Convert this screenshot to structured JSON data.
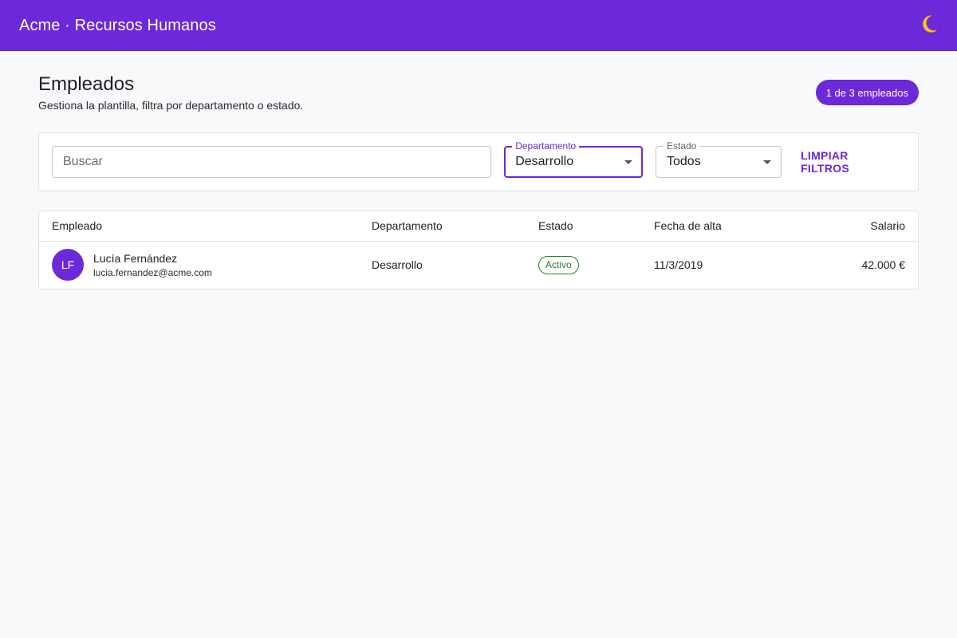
{
  "appbar": {
    "title": "Acme · Recursos Humanos",
    "theme_icon": "moon-icon",
    "color": "#6d28d9"
  },
  "page": {
    "title": "Empleados",
    "subtitle": "Gestiona la plantilla, filtra por departamento o estado.",
    "count_chip": "1 de 3 empleados"
  },
  "filters": {
    "search": {
      "placeholder": "Buscar",
      "value": ""
    },
    "department": {
      "label": "Departamento",
      "value": "Desarrollo"
    },
    "status": {
      "label": "Estado",
      "value": "Todos"
    },
    "clear_label": "LIMPIAR FILTROS"
  },
  "table": {
    "headers": {
      "employee": "Empleado",
      "department": "Departamento",
      "status": "Estado",
      "hire_date": "Fecha de alta",
      "salary": "Salario"
    },
    "rows": [
      {
        "initials": "LF",
        "name": "Lucía Fernández",
        "email": "lucia.fernandez@acme.com",
        "department": "Desarrollo",
        "status": "Activo",
        "hire_date": "11/3/2019",
        "salary": "42.000 €"
      }
    ]
  },
  "colors": {
    "accent": "#6d28d9",
    "status_active": "#2e7d32",
    "background": "#f8f9fb"
  }
}
